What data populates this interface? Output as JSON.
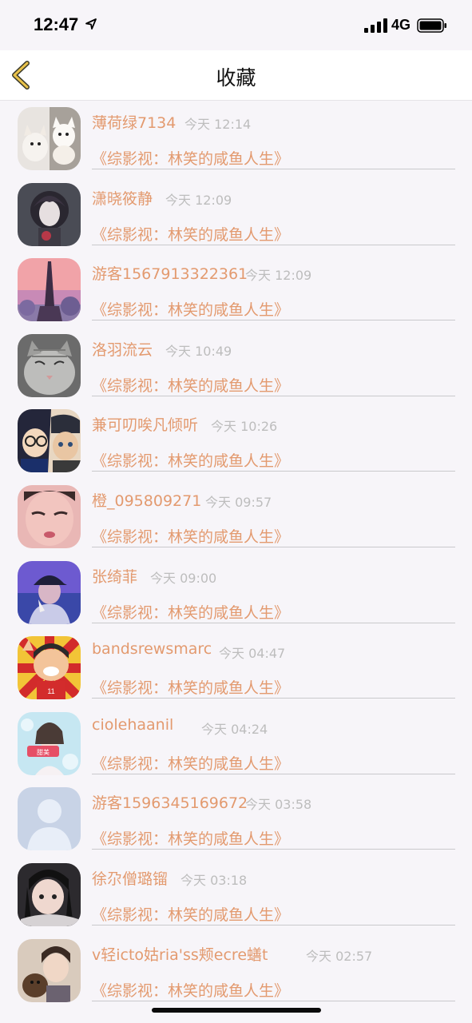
{
  "status_bar": {
    "time": "12:47",
    "network": "4G",
    "icons": [
      "location-arrow-icon",
      "signal-icon",
      "battery-icon"
    ]
  },
  "header": {
    "title": "收藏",
    "back_icon": "chevron-left-icon"
  },
  "colors": {
    "accent": "#e39a6f",
    "timestamp": "#bdbdbd",
    "background": "#f7f5f9"
  },
  "items": [
    {
      "name": "薄荷绿7134",
      "time": "今天 12:14",
      "book": "《综影视：林笑的咸鱼人生》",
      "avatar": "white-puppies"
    },
    {
      "name": "潇晓筱静",
      "time": "今天 12:09",
      "book": "《综影视：林笑的咸鱼人生》",
      "avatar": "dark-hair-girl"
    },
    {
      "name": "游客1567913322361",
      "time": "今天 12:09",
      "book": "《综影视：林笑的咸鱼人生》",
      "avatar": "pink-sky-tower"
    },
    {
      "name": "洛羽流云",
      "time": "今天 10:49",
      "book": "《综影视：林笑的咸鱼人生》",
      "avatar": "grey-kitten"
    },
    {
      "name": "兼可叨唉凡倾听",
      "time": "今天 10:26",
      "book": "《综影视：林笑的咸鱼人生》",
      "avatar": "anime-detectives"
    },
    {
      "name": "橙_095809271",
      "time": "今天 09:57",
      "book": "《综影视：林笑的咸鱼人生》",
      "avatar": "selfie-face"
    },
    {
      "name": "张绮菲",
      "time": "今天 09:00",
      "book": "《综影视：林笑的咸鱼人生》",
      "avatar": "blue-cap-person"
    },
    {
      "name": "bandsrewsmarc",
      "time": "今天 04:47",
      "book": "《综影视：林笑的咸鱼人生》",
      "avatar": "cartoon-player"
    },
    {
      "name": "ciolehaanil",
      "time": "今天 04:24",
      "book": "《综影视：林笑的咸鱼人生》",
      "avatar": "girl-light-blue"
    },
    {
      "name": "游客1596345169672",
      "time": "今天 03:58",
      "book": "《综影视：林笑的咸鱼人生》",
      "avatar": "default-silhouette"
    },
    {
      "name": "徐尕僧璐镏",
      "time": "今天 03:18",
      "book": "《综影视：林笑的咸鱼人生》",
      "avatar": "dark-hair-portrait"
    },
    {
      "name": "v轻icto姑ria'ss颊ecre蟮t",
      "time": "今天 02:57",
      "book": "《综影视：林笑的咸鱼人生》",
      "avatar": "boy-with-cat"
    }
  ]
}
